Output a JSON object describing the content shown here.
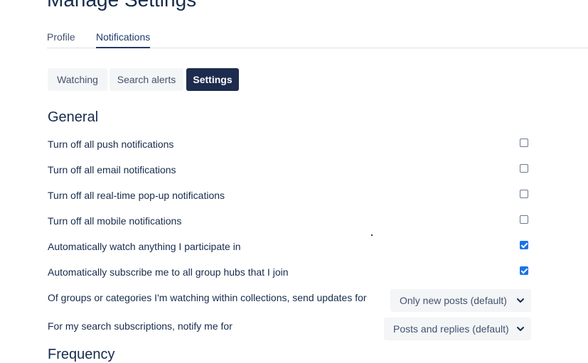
{
  "page": {
    "title": "Manage Settings"
  },
  "top_tabs": [
    {
      "label": "Profile",
      "active": false
    },
    {
      "label": "Notifications",
      "active": true
    }
  ],
  "sub_tabs": [
    {
      "label": "Watching",
      "active": false
    },
    {
      "label": "Search alerts",
      "active": false
    },
    {
      "label": "Settings",
      "active": true
    }
  ],
  "general": {
    "title": "General",
    "rows": [
      {
        "label": "Turn off all push notifications",
        "checked": false
      },
      {
        "label": "Turn off all email notifications",
        "checked": false
      },
      {
        "label": "Turn off all real-time pop-up notifications",
        "checked": false
      },
      {
        "label": "Turn off all mobile notifications",
        "checked": false
      },
      {
        "label": "Automatically watch anything I participate in",
        "checked": true
      },
      {
        "label": "Automatically subscribe me to all group hubs that I join",
        "checked": true
      }
    ],
    "selects": [
      {
        "label": "Of groups or categories I'm watching within collections, send updates for",
        "value": "Only new posts (default)"
      },
      {
        "label": "For my search subscriptions, notify me for",
        "value": "Posts and replies (default)"
      }
    ]
  },
  "frequency": {
    "title": "Frequency"
  },
  "colors": {
    "accent": "#1d2b4e",
    "checkbox_checked": "#1a73e8",
    "text": "#172b4d"
  }
}
